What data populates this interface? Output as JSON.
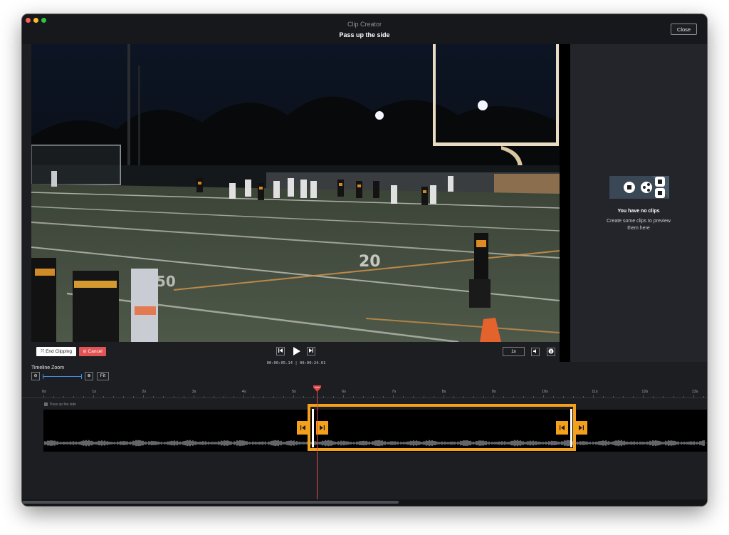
{
  "window": {
    "app_name": "Clip Creator",
    "clip_title": "Pass up the side",
    "close_label": "Close",
    "traffic_colors": [
      "#ff5f57",
      "#febc2e",
      "#28c840"
    ]
  },
  "video": {
    "description_icon": "football-game-video-frame"
  },
  "controls": {
    "end_clipping_label": "End Clipping",
    "end_clipping_icon": "crop-icon",
    "cancel_label": "Cancel",
    "cancel_icon": "cancel-circle-icon",
    "prev_icon": "skip-back-icon",
    "play_icon": "play-icon",
    "next_icon": "skip-forward-icon",
    "timecode": "00:00:05.14 | 00:00:24.01",
    "speed_label": "1x",
    "volume_icon": "volume-icon",
    "info_icon": "info-icon"
  },
  "right_panel": {
    "title": "You have no clips",
    "description": "Create some clips to preview them here",
    "illustration_icons": [
      "stop-icon",
      "share-icon",
      "clip-icon"
    ]
  },
  "timeline": {
    "zoom_label": "Timeline Zoom",
    "zoom_out_icon": "zoom-out-icon",
    "zoom_in_icon": "zoom-in-icon",
    "fit_label": "Fit",
    "ticks": [
      "0s",
      "1s",
      "2s",
      "3s",
      "4s",
      "5s",
      "6s",
      "7s",
      "8s",
      "9s",
      "10s",
      "11s",
      "12s",
      "13s"
    ],
    "track_label": "Pass up the side",
    "playhead_seconds": 5.14,
    "clip_start_seconds": 5.0,
    "clip_end_seconds": 10.4,
    "accent_color": "#f5a01a",
    "playhead_color": "#e24848"
  }
}
